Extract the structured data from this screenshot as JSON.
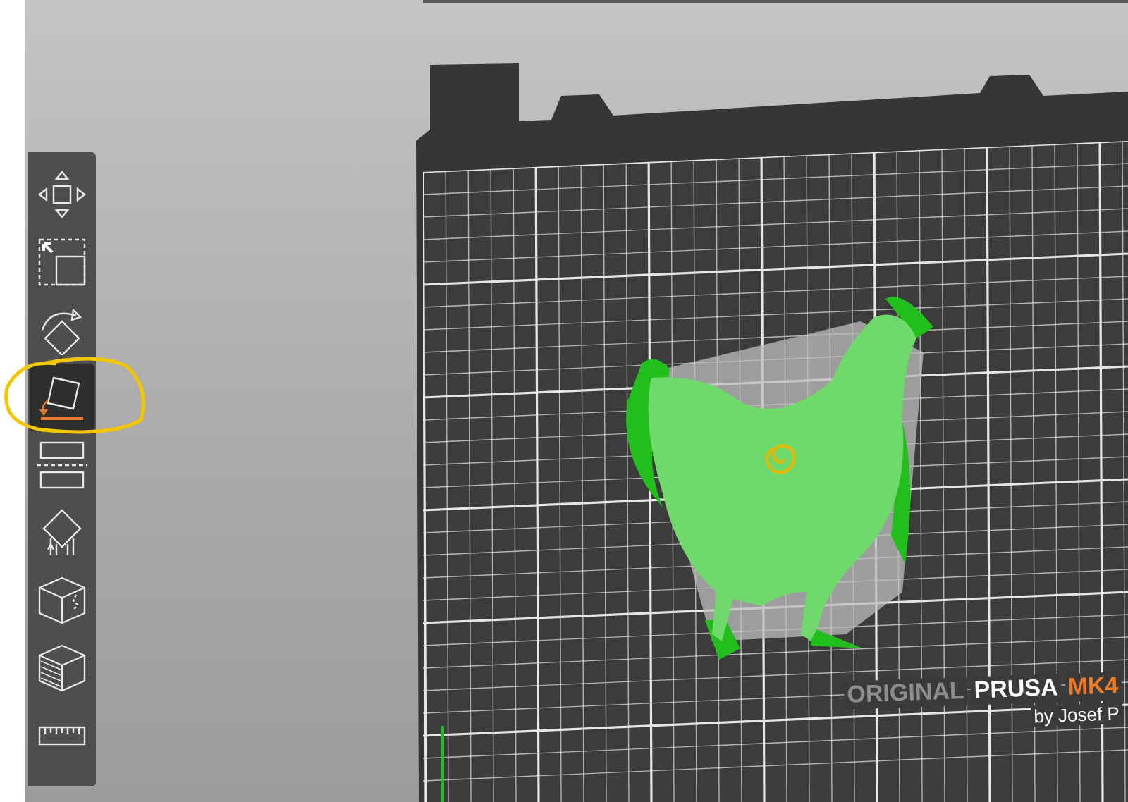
{
  "toolbar": {
    "tools": [
      {
        "kind": "move",
        "selected": false
      },
      {
        "kind": "scale",
        "selected": false
      },
      {
        "kind": "rotate",
        "selected": false
      },
      {
        "kind": "place-on-face",
        "selected": true
      },
      {
        "kind": "cut",
        "selected": false
      },
      {
        "kind": "supports",
        "selected": false
      },
      {
        "kind": "seam",
        "selected": false
      },
      {
        "kind": "texture",
        "selected": false
      },
      {
        "kind": "measure",
        "selected": false
      }
    ]
  },
  "bed_logo": {
    "line_1": [
      "ORIGINAL",
      "PRUSA",
      "MK4"
    ],
    "line_2": "by Josef P"
  }
}
